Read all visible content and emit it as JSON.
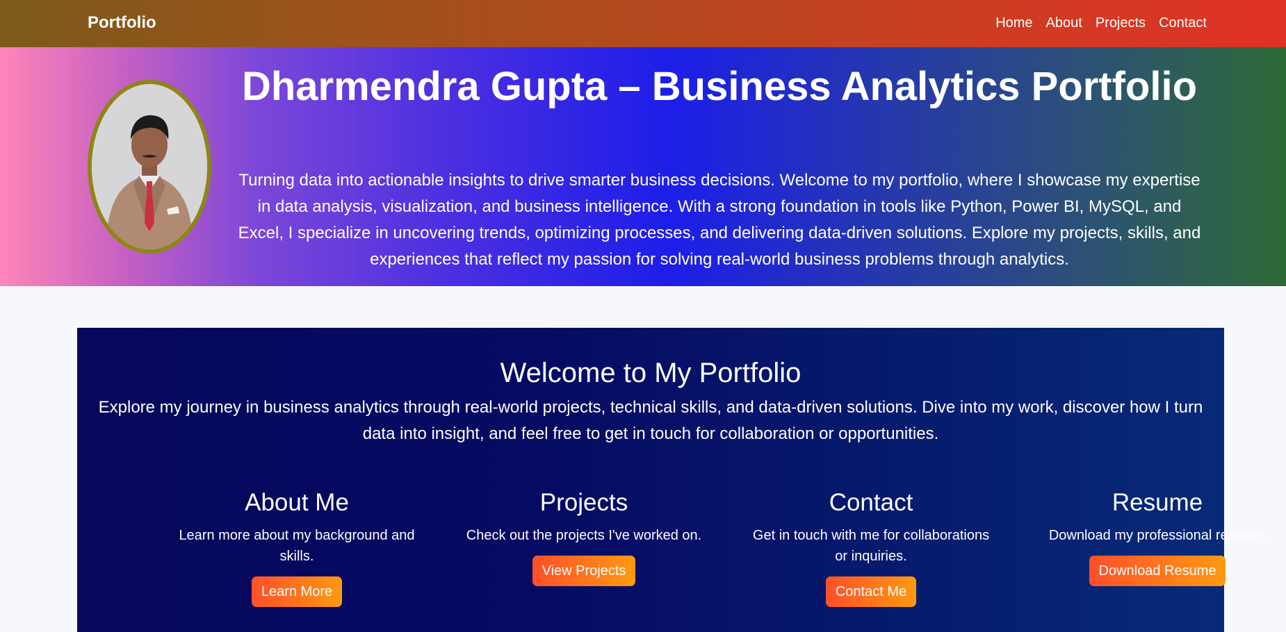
{
  "navbar": {
    "brand": "Portfolio",
    "links": [
      "Home",
      "About",
      "Projects",
      "Contact"
    ]
  },
  "hero": {
    "title": "Dharmendra Gupta – Business Analytics Portfolio",
    "description": "Turning data into actionable insights to drive smarter business decisions. Welcome to my portfolio, where I showcase my expertise in data analysis, visualization, and business intelligence. With a strong foundation in tools like Python, Power BI, MySQL, and Excel, I specialize in uncovering trends, optimizing processes, and delivering data-driven solutions. Explore my projects, skills, and experiences that reflect my passion for solving real-world business problems through analytics."
  },
  "welcome": {
    "heading": "Welcome to My Portfolio",
    "intro": "Explore my journey in business analytics through real-world projects, technical skills, and data-driven solutions. Dive into my work, discover how I turn data into insight, and feel free to get in touch for collaboration or opportunities.",
    "cards": [
      {
        "title": "About Me",
        "text": "Learn more about my background and skills.",
        "button": "Learn More"
      },
      {
        "title": "Projects",
        "text": "Check out the projects I've worked on.",
        "button": "View Projects"
      },
      {
        "title": "Contact",
        "text": "Get in touch with me for collaborations or inquiries.",
        "button": "Contact Me"
      },
      {
        "title": "Resume",
        "text": "Download my professional resume.",
        "button": "Download Resume"
      }
    ]
  },
  "colors": {
    "button_start": "#ff4f2a",
    "button_end": "#ff9a10",
    "avatar_border": "#8d8614",
    "welcome_bg": "#07075c"
  }
}
